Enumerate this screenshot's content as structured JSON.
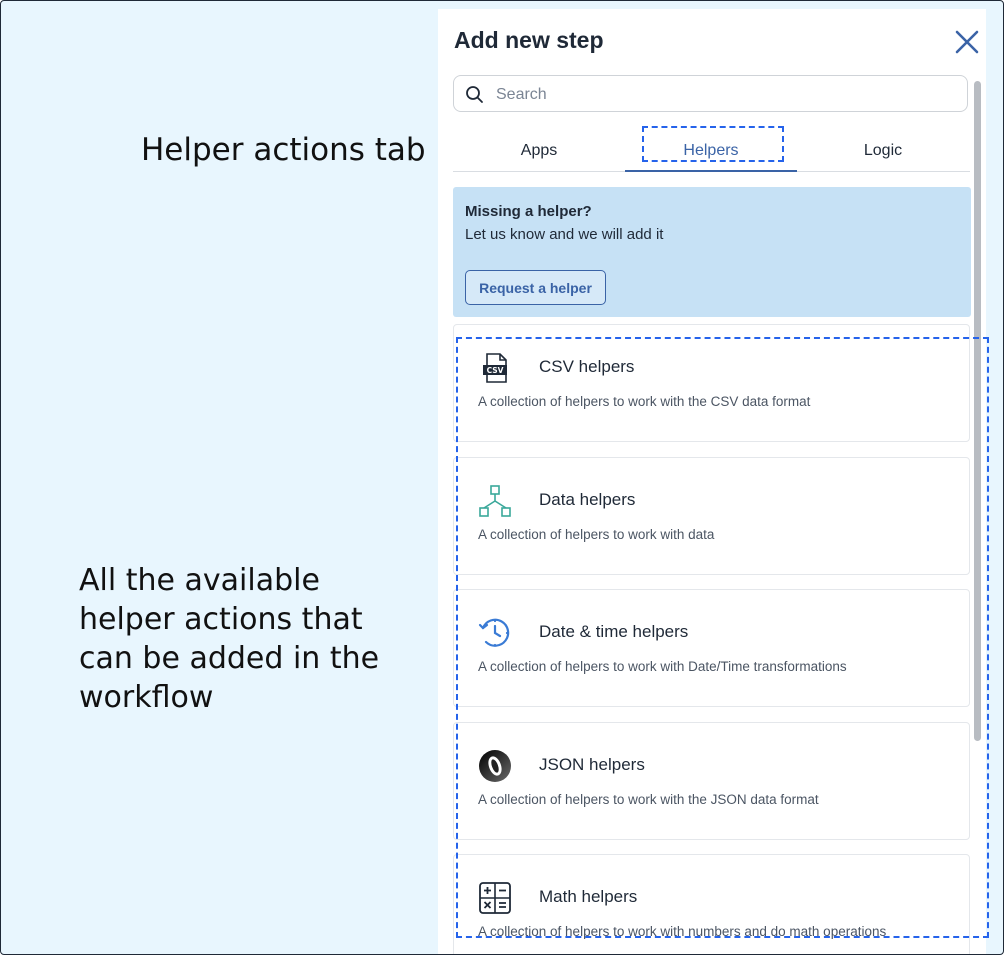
{
  "annotations": {
    "tab_note": "Helper actions tab",
    "list_note": "All the available helper actions that can be added in the workflow"
  },
  "panel": {
    "title": "Add new step",
    "close_icon": "close-icon"
  },
  "search": {
    "placeholder": "Search",
    "value": ""
  },
  "tabs": [
    {
      "label": "Apps",
      "active": false
    },
    {
      "label": "Helpers",
      "active": true
    },
    {
      "label": "Logic",
      "active": false
    }
  ],
  "banner": {
    "title": "Missing a helper?",
    "text": "Let us know and we will add it",
    "button_label": "Request a helper"
  },
  "helpers": [
    {
      "name": "CSV helpers",
      "description": "A collection of helpers to work with the CSV data format",
      "icon": "csv-file-icon"
    },
    {
      "name": "Data helpers",
      "description": "A collection of helpers to work with data",
      "icon": "data-tree-icon"
    },
    {
      "name": "Date & time helpers",
      "description": "A collection of helpers to work with Date/Time transformations",
      "icon": "clock-icon"
    },
    {
      "name": "JSON helpers",
      "description": "A collection of helpers to work with the JSON data format",
      "icon": "json-icon"
    },
    {
      "name": "Math helpers",
      "description": "A collection of helpers to work with numbers and do math operations",
      "icon": "calculator-icon"
    }
  ],
  "colors": {
    "accent": "#3a63a6",
    "background": "#e8f6fe",
    "banner": "#c6e1f5",
    "annotation_outline": "#2563eb"
  }
}
